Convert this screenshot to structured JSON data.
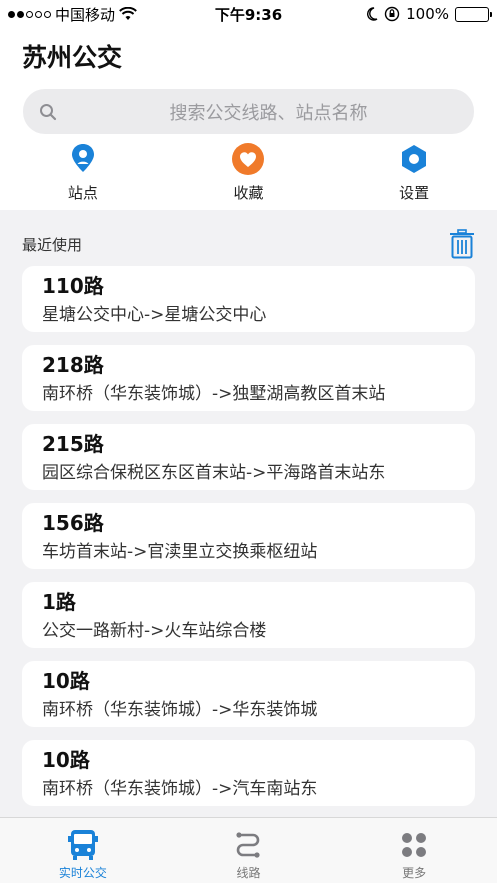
{
  "status_bar": {
    "carrier": "中国移动",
    "time": "下午9:36",
    "battery": "100%"
  },
  "app": {
    "title": "苏州公交"
  },
  "search": {
    "placeholder": "搜索公交线路、站点名称"
  },
  "quick_actions": [
    {
      "label": "站点",
      "icon": "location-pin-icon",
      "color": "#1a82d8"
    },
    {
      "label": "收藏",
      "icon": "heart-icon",
      "color": "#f07a2a"
    },
    {
      "label": "设置",
      "icon": "gear-icon",
      "color": "#1a82d8"
    }
  ],
  "recent": {
    "title": "最近使用",
    "items": [
      {
        "route": "110路",
        "direction": "星塘公交中心->星塘公交中心"
      },
      {
        "route": "218路",
        "direction": "南环桥（华东装饰城）->独墅湖高教区首末站"
      },
      {
        "route": "215路",
        "direction": "园区综合保税区东区首末站->平海路首末站东"
      },
      {
        "route": "156路",
        "direction": "车坊首末站->官渎里立交换乘枢纽站"
      },
      {
        "route": "1路",
        "direction": "公交一路新村->火车站综合楼"
      },
      {
        "route": "10路",
        "direction": "南环桥（华东装饰城）->华东装饰城"
      },
      {
        "route": "10路",
        "direction": "南环桥（华东装饰城）->汽车南站东"
      }
    ]
  },
  "tabbar": {
    "tabs": [
      {
        "label": "实时公交",
        "icon": "bus-icon",
        "active": true
      },
      {
        "label": "线路",
        "icon": "route-icon",
        "active": false
      },
      {
        "label": "更多",
        "icon": "grid-icon",
        "active": false
      }
    ]
  },
  "colors": {
    "accent": "#1a82d8",
    "favorite": "#f07a2a",
    "battery": "#4cd964"
  }
}
